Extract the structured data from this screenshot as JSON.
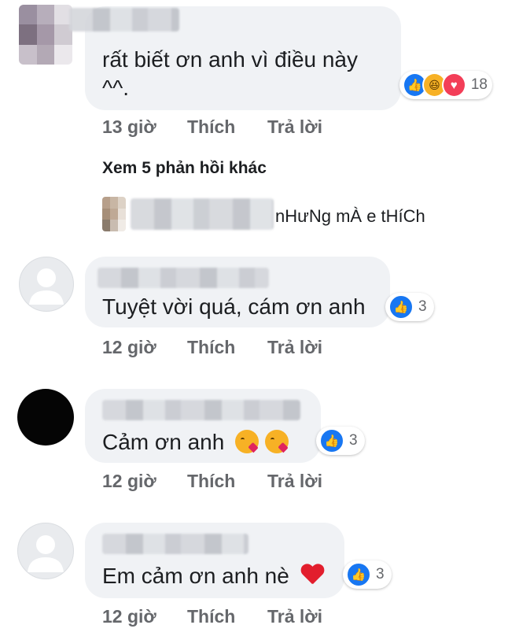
{
  "comments": [
    {
      "text_line1": "rất biết ơn anh vì điều này",
      "text_line2": "^^.",
      "reaction_icons": [
        "like-icon",
        "haha-icon",
        "love-icon"
      ],
      "reaction_count": "18",
      "time": "13 giờ",
      "like_label": "Thích",
      "reply_label": "Trả lời"
    },
    {
      "text": "Tuyệt vời quá, cám ơn anh",
      "reaction_icons": [
        "like-icon"
      ],
      "reaction_count": "3",
      "time": "12 giờ",
      "like_label": "Thích",
      "reply_label": "Trả lời"
    },
    {
      "text": "Cảm ơn anh",
      "emojis": [
        "kissing-heart-icon",
        "kissing-heart-icon"
      ],
      "reaction_icons": [
        "like-icon"
      ],
      "reaction_count": "3",
      "time": "12 giờ",
      "like_label": "Thích",
      "reply_label": "Trả lời"
    },
    {
      "text": "Em cảm ơn anh nè",
      "emojis": [
        "red-heart-icon"
      ],
      "reaction_icons": [
        "like-icon"
      ],
      "reaction_count": "3",
      "time": "12 giờ",
      "like_label": "Thích",
      "reply_label": "Trả lời"
    }
  ],
  "replies": {
    "see_more_label": "Xem 5 phản hồi khác",
    "preview_text": "nHưNg mÀ e tHíCh"
  },
  "colors": {
    "bubble": "#f0f2f5",
    "like_blue": "#1877f2",
    "love_red": "#f33e58",
    "meta_gray": "#65676b"
  }
}
